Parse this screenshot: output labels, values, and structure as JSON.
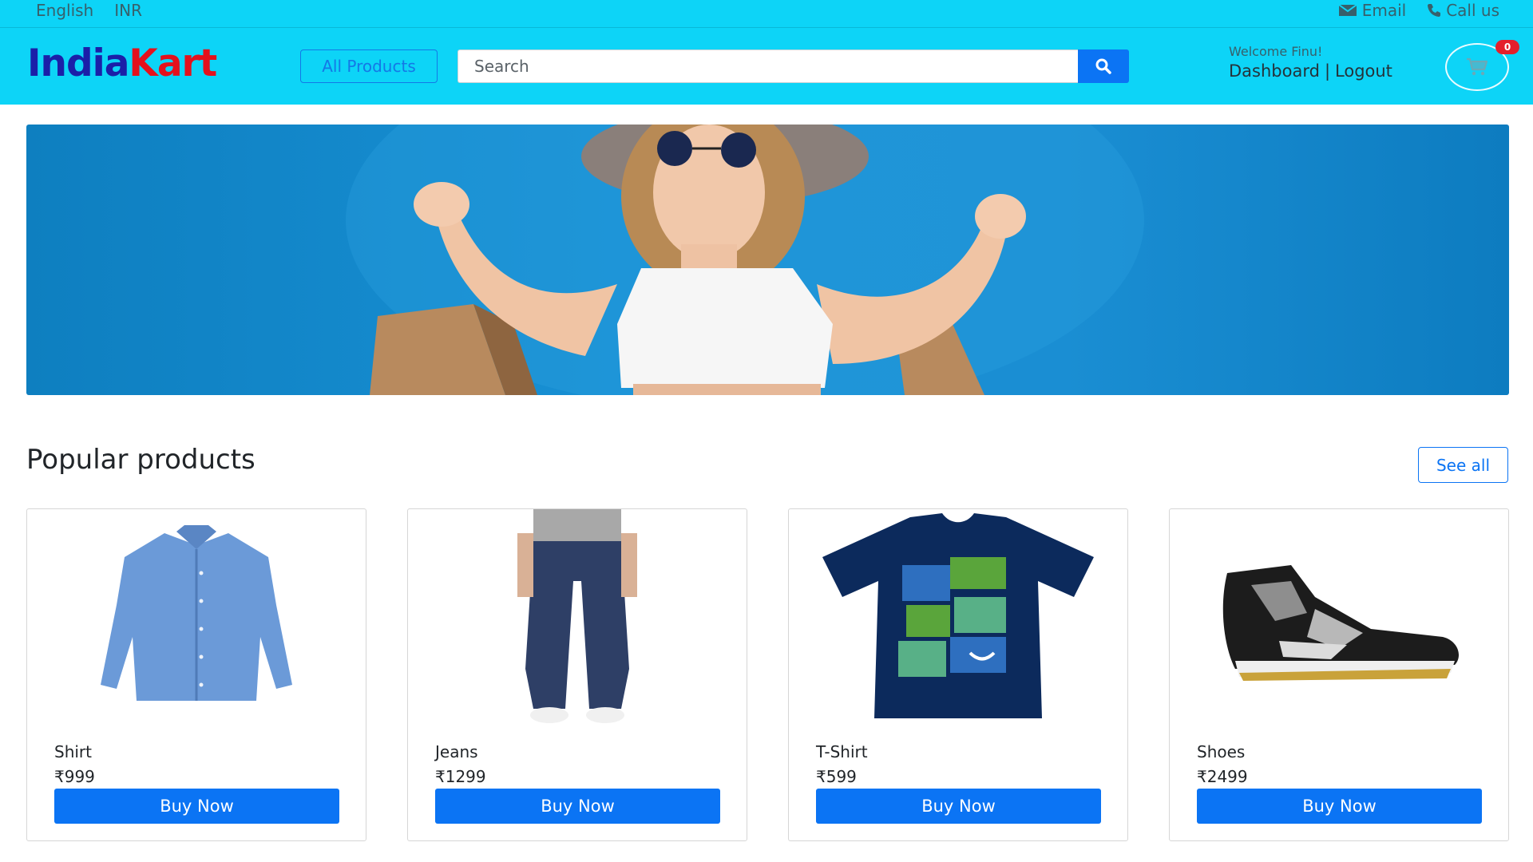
{
  "topbar": {
    "language": "English",
    "currency": "INR",
    "email_label": "Email",
    "call_label": "Call us"
  },
  "header": {
    "logo_part1": "India",
    "logo_part2": "Kart",
    "all_products_label": "All Products",
    "search_placeholder": "Search",
    "welcome_text": "Welcome Finu!",
    "dashboard_label": "Dashboard",
    "separator": "|",
    "logout_label": "Logout",
    "cart_count": "0"
  },
  "colors": {
    "header_bg": "#0dd4f7",
    "logo_blue": "#1b1fa8",
    "logo_red": "#e4111c",
    "primary": "#0b74f4",
    "banner_bg": "#1890d4",
    "badge_red": "#e41f2b"
  },
  "section": {
    "title": "Popular products",
    "see_all_label": "See all"
  },
  "products": [
    {
      "name": "Shirt",
      "price": "₹999",
      "button": "Buy Now",
      "icon": "shirt-image"
    },
    {
      "name": "Jeans",
      "price": "₹1299",
      "button": "Buy Now",
      "icon": "jeans-image"
    },
    {
      "name": "T-Shirt",
      "price": "₹599",
      "button": "Buy Now",
      "icon": "tshirt-image"
    },
    {
      "name": "Shoes",
      "price": "₹2499",
      "button": "Buy Now",
      "icon": "shoes-image"
    }
  ]
}
